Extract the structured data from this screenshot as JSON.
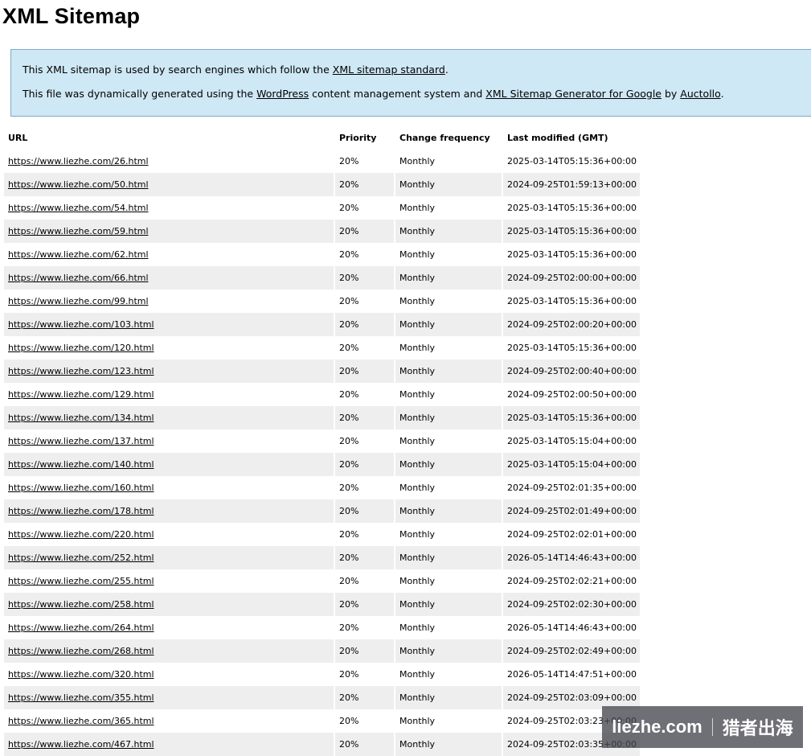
{
  "page": {
    "title": "XML Sitemap"
  },
  "intro": {
    "line1_prefix": "This XML sitemap is used by search engines which follow the ",
    "line1_link": "XML sitemap standard",
    "line1_suffix": ".",
    "line2_prefix": "This file was dynamically generated using the ",
    "line2_link1": "WordPress",
    "line2_mid1": " content management system and ",
    "line2_link2": "XML Sitemap Generator for Google",
    "line2_mid2": " by ",
    "line2_link3": "Auctollo",
    "line2_suffix": "."
  },
  "table": {
    "headers": [
      "URL",
      "Priority",
      "Change frequency",
      "Last modified (GMT)"
    ],
    "rows": [
      {
        "url": "https://www.liezhe.com/26.html",
        "priority": "20%",
        "freq": "Monthly",
        "modified": "2025-03-14T05:15:36+00:00"
      },
      {
        "url": "https://www.liezhe.com/50.html",
        "priority": "20%",
        "freq": "Monthly",
        "modified": "2024-09-25T01:59:13+00:00"
      },
      {
        "url": "https://www.liezhe.com/54.html",
        "priority": "20%",
        "freq": "Monthly",
        "modified": "2025-03-14T05:15:36+00:00"
      },
      {
        "url": "https://www.liezhe.com/59.html",
        "priority": "20%",
        "freq": "Monthly",
        "modified": "2025-03-14T05:15:36+00:00"
      },
      {
        "url": "https://www.liezhe.com/62.html",
        "priority": "20%",
        "freq": "Monthly",
        "modified": "2025-03-14T05:15:36+00:00"
      },
      {
        "url": "https://www.liezhe.com/66.html",
        "priority": "20%",
        "freq": "Monthly",
        "modified": "2024-09-25T02:00:00+00:00"
      },
      {
        "url": "https://www.liezhe.com/99.html",
        "priority": "20%",
        "freq": "Monthly",
        "modified": "2025-03-14T05:15:36+00:00"
      },
      {
        "url": "https://www.liezhe.com/103.html",
        "priority": "20%",
        "freq": "Monthly",
        "modified": "2024-09-25T02:00:20+00:00"
      },
      {
        "url": "https://www.liezhe.com/120.html",
        "priority": "20%",
        "freq": "Monthly",
        "modified": "2025-03-14T05:15:36+00:00"
      },
      {
        "url": "https://www.liezhe.com/123.html",
        "priority": "20%",
        "freq": "Monthly",
        "modified": "2024-09-25T02:00:40+00:00"
      },
      {
        "url": "https://www.liezhe.com/129.html",
        "priority": "20%",
        "freq": "Monthly",
        "modified": "2024-09-25T02:00:50+00:00"
      },
      {
        "url": "https://www.liezhe.com/134.html",
        "priority": "20%",
        "freq": "Monthly",
        "modified": "2025-03-14T05:15:36+00:00"
      },
      {
        "url": "https://www.liezhe.com/137.html",
        "priority": "20%",
        "freq": "Monthly",
        "modified": "2025-03-14T05:15:04+00:00"
      },
      {
        "url": "https://www.liezhe.com/140.html",
        "priority": "20%",
        "freq": "Monthly",
        "modified": "2025-03-14T05:15:04+00:00"
      },
      {
        "url": "https://www.liezhe.com/160.html",
        "priority": "20%",
        "freq": "Monthly",
        "modified": "2024-09-25T02:01:35+00:00"
      },
      {
        "url": "https://www.liezhe.com/178.html",
        "priority": "20%",
        "freq": "Monthly",
        "modified": "2024-09-25T02:01:49+00:00"
      },
      {
        "url": "https://www.liezhe.com/220.html",
        "priority": "20%",
        "freq": "Monthly",
        "modified": "2024-09-25T02:02:01+00:00"
      },
      {
        "url": "https://www.liezhe.com/252.html",
        "priority": "20%",
        "freq": "Monthly",
        "modified": "2026-05-14T14:46:43+00:00"
      },
      {
        "url": "https://www.liezhe.com/255.html",
        "priority": "20%",
        "freq": "Monthly",
        "modified": "2024-09-25T02:02:21+00:00"
      },
      {
        "url": "https://www.liezhe.com/258.html",
        "priority": "20%",
        "freq": "Monthly",
        "modified": "2024-09-25T02:02:30+00:00"
      },
      {
        "url": "https://www.liezhe.com/264.html",
        "priority": "20%",
        "freq": "Monthly",
        "modified": "2026-05-14T14:46:43+00:00"
      },
      {
        "url": "https://www.liezhe.com/268.html",
        "priority": "20%",
        "freq": "Monthly",
        "modified": "2024-09-25T02:02:49+00:00"
      },
      {
        "url": "https://www.liezhe.com/320.html",
        "priority": "20%",
        "freq": "Monthly",
        "modified": "2026-05-14T14:47:51+00:00"
      },
      {
        "url": "https://www.liezhe.com/355.html",
        "priority": "20%",
        "freq": "Monthly",
        "modified": "2024-09-25T02:03:09+00:00"
      },
      {
        "url": "https://www.liezhe.com/365.html",
        "priority": "20%",
        "freq": "Monthly",
        "modified": "2024-09-25T02:03:23+00:00"
      },
      {
        "url": "https://www.liezhe.com/467.html",
        "priority": "20%",
        "freq": "Monthly",
        "modified": "2024-09-25T02:03:35+00:00"
      }
    ]
  },
  "watermark": {
    "domain": "liezhe.com",
    "brand": "猎者出海"
  },
  "colors": {
    "intro_background": "#cfe8f5",
    "alt_row": "#eeeeee"
  }
}
